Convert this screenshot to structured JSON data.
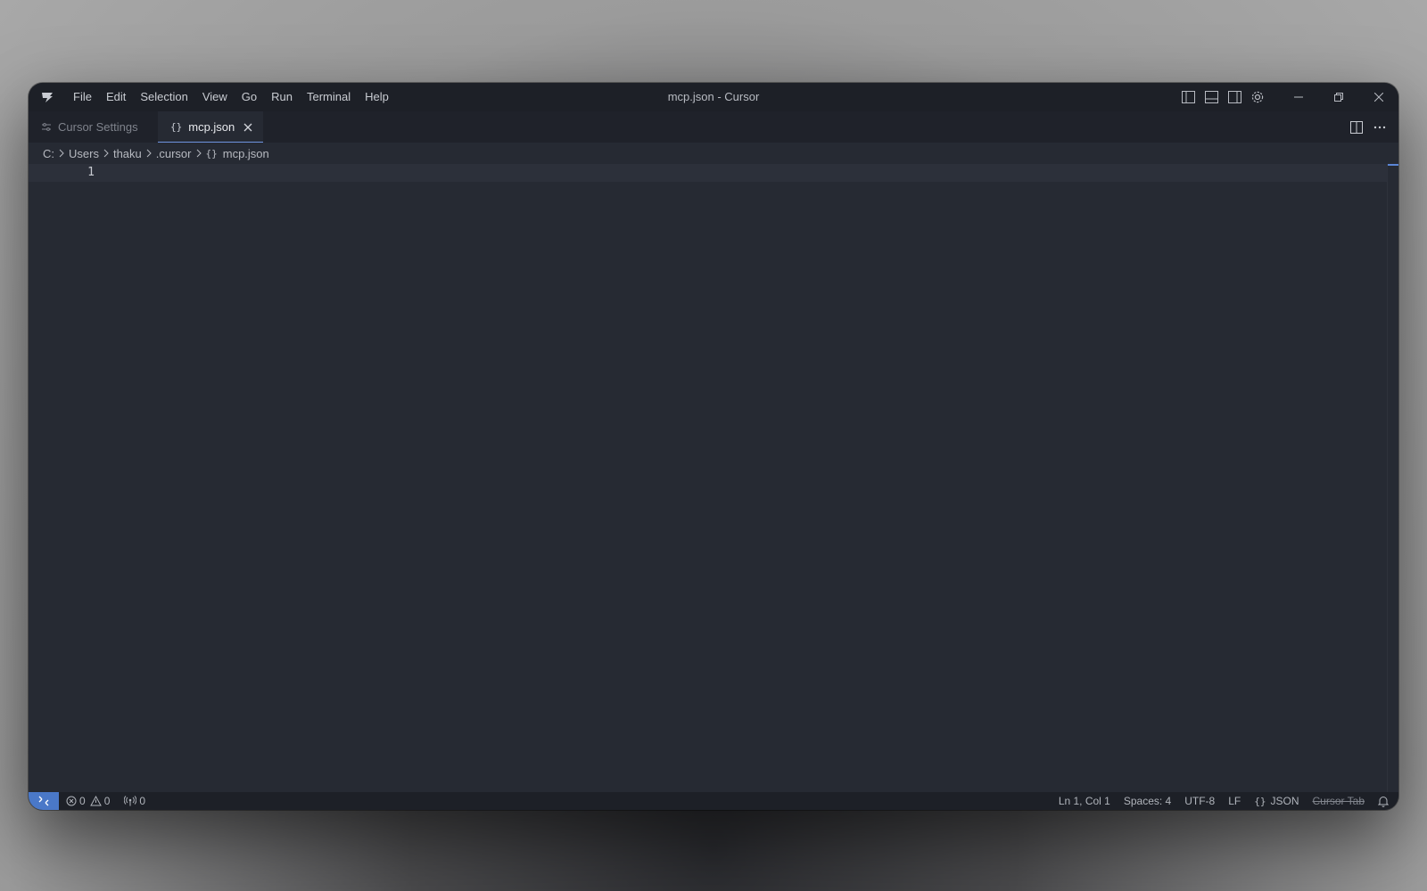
{
  "window": {
    "title": "mcp.json - Cursor"
  },
  "menu": {
    "items": [
      "File",
      "Edit",
      "Selection",
      "View",
      "Go",
      "Run",
      "Terminal",
      "Help"
    ]
  },
  "tabs": [
    {
      "label": "Cursor Settings",
      "icon": "settings-sliders-icon",
      "active": false
    },
    {
      "label": "mcp.json",
      "icon": "json-braces-icon",
      "active": true
    }
  ],
  "breadcrumb": {
    "drive": "C:",
    "segments": [
      "Users",
      "thaku",
      ".cursor"
    ],
    "file": "mcp.json"
  },
  "editor": {
    "line_numbers": [
      "1"
    ]
  },
  "status": {
    "errors": "0",
    "warnings": "0",
    "ports": "0",
    "cursor_position": "Ln 1, Col 1",
    "indentation": "Spaces: 4",
    "encoding": "UTF-8",
    "eol": "LF",
    "language": "JSON",
    "cursor_tab": "Cursor Tab"
  },
  "colors": {
    "accent": "#4a78c8",
    "background": "#262a33",
    "titlebar": "#1d2027"
  }
}
